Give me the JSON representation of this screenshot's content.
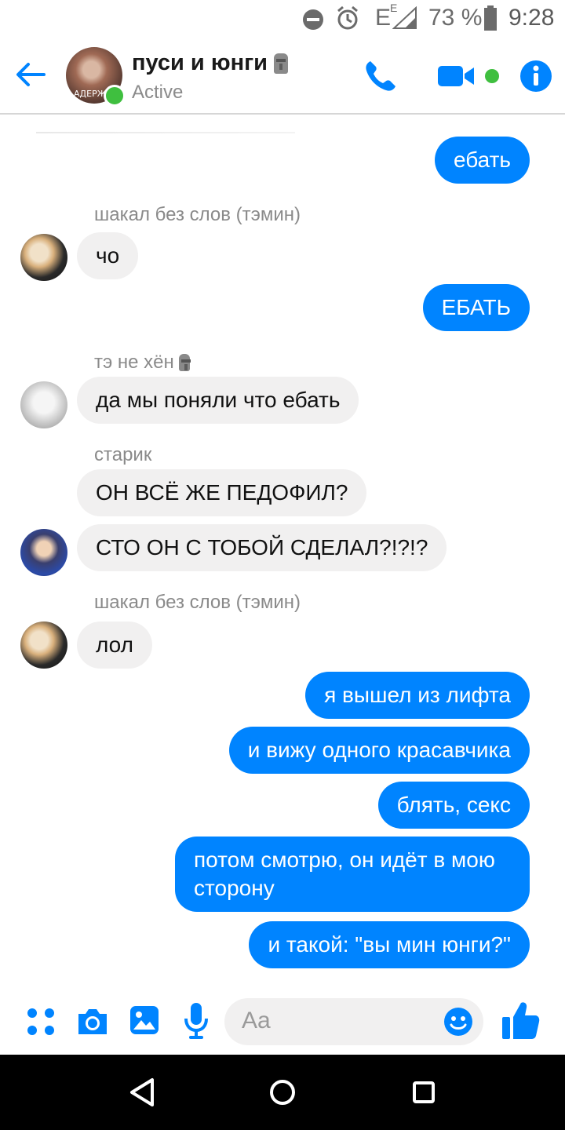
{
  "status_bar": {
    "network": "E",
    "network_sup": "E",
    "battery": "73 %",
    "time": "9:28"
  },
  "header": {
    "title": "пуси и юнги",
    "status": "Active",
    "avatar_caption": "АДЕРЖ"
  },
  "colors": {
    "accent": "#0084ff",
    "online": "#3fbf3f",
    "incoming_bubble": "#f1f0f0"
  },
  "messages": [
    {
      "dir": "out",
      "text": "ебать"
    },
    {
      "sender": "шакал без слов (тэмин)"
    },
    {
      "dir": "in",
      "text": "чо"
    },
    {
      "dir": "out",
      "text": "ЕБАТЬ"
    },
    {
      "sender": "тэ не хён"
    },
    {
      "dir": "in",
      "text": "да мы поняли что ебать"
    },
    {
      "sender": "старик"
    },
    {
      "dir": "in",
      "text": "ОН ВСЁ ЖЕ ПЕДОФИЛ?"
    },
    {
      "dir": "in",
      "text": "СТО ОН С ТОБОЙ СДЕЛАЛ?!?!?"
    },
    {
      "sender": "шакал без слов (тэмин)"
    },
    {
      "dir": "in",
      "text": "лол"
    },
    {
      "dir": "out",
      "text": "я вышел из лифта"
    },
    {
      "dir": "out",
      "text": "и вижу одного красавчика"
    },
    {
      "dir": "out",
      "text": "блять, секс"
    },
    {
      "dir": "out",
      "text": "потом смотрю, он идёт в мою сторону"
    },
    {
      "dir": "out",
      "text": "и такой: \"вы мин юнги?\""
    }
  ],
  "composer": {
    "placeholder": "Aa"
  },
  "icons": {
    "back": "arrow-left-icon",
    "call": "phone-icon",
    "video": "video-camera-icon",
    "info": "info-icon",
    "more": "four-dots-icon",
    "camera": "camera-icon",
    "gallery": "image-icon",
    "mic": "microphone-icon",
    "emoji": "smiley-icon",
    "like": "thumbs-up-icon"
  }
}
